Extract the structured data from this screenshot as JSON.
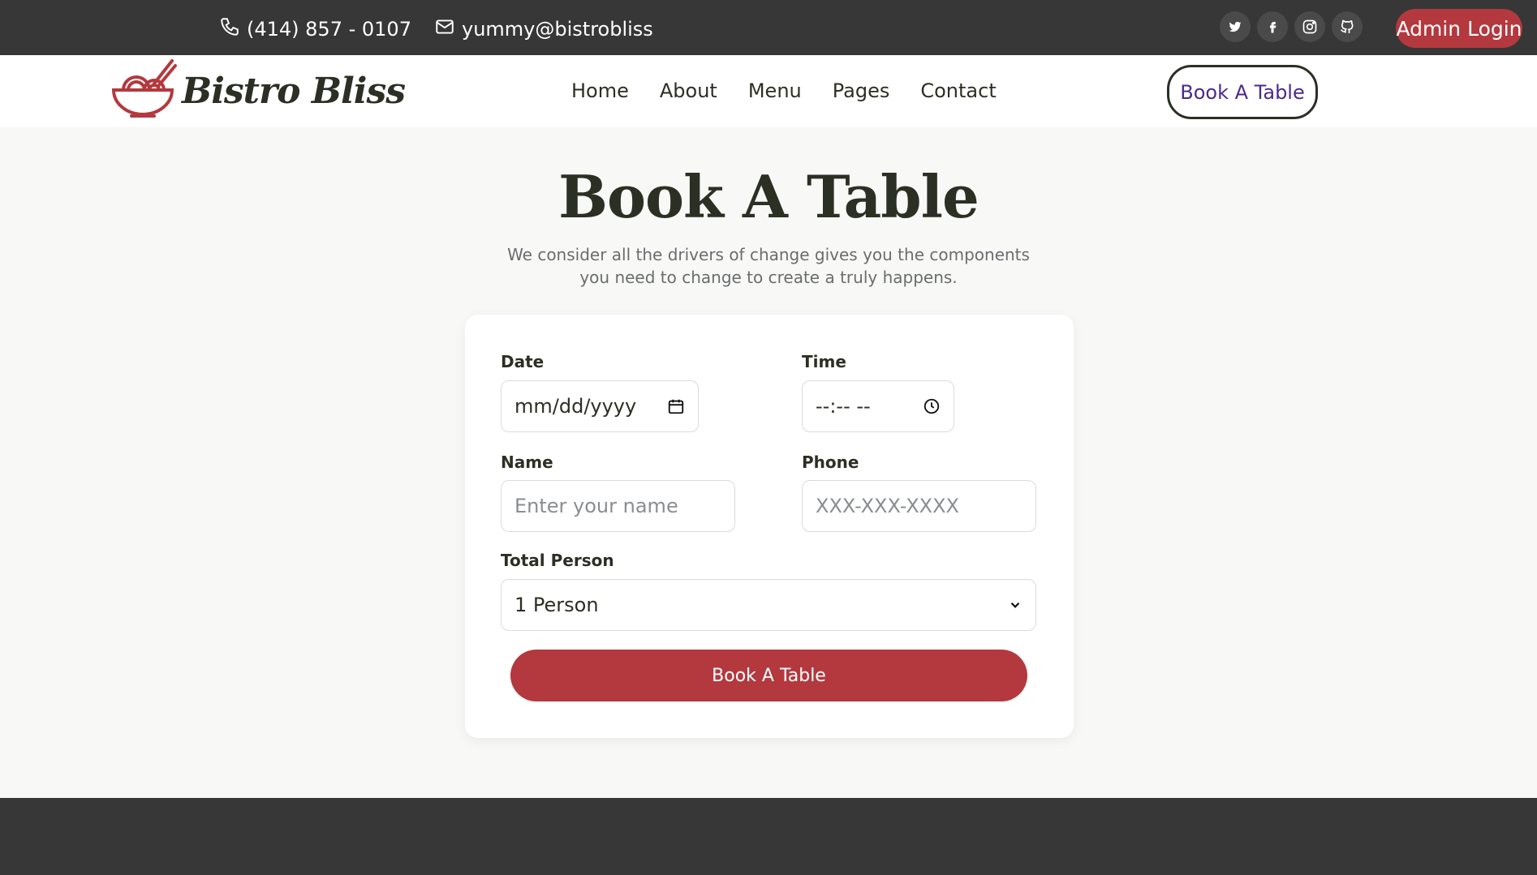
{
  "topbar": {
    "phone": "(414) 857 - 0107",
    "email": "yummy@bistrobliss",
    "socials": [
      "twitter-icon",
      "facebook-icon",
      "instagram-icon",
      "github-icon"
    ],
    "admin_login": "Admin Login"
  },
  "navbar": {
    "logo_text": "Bistro Bliss",
    "links": [
      "Home",
      "About",
      "Menu",
      "Pages",
      "Contact"
    ],
    "book_button": "Book A Table"
  },
  "hero": {
    "title": "Book A Table",
    "subtitle": "We consider all the drivers of change gives you the components you need to change to create a truly happens."
  },
  "form": {
    "date_label": "Date",
    "date_value": "mm/dd/yyyy",
    "time_label": "Time",
    "time_value": "--:-- --",
    "name_label": "Name",
    "name_placeholder": "Enter your name",
    "phone_label": "Phone",
    "phone_placeholder": "XXX-XXX-XXXX",
    "persons_label": "Total Person",
    "persons_value": "1 Person",
    "submit": "Book A Table"
  },
  "colors": {
    "accent": "#b3393e",
    "dark": "#373737",
    "nav_button_text": "#4b2a8a"
  }
}
